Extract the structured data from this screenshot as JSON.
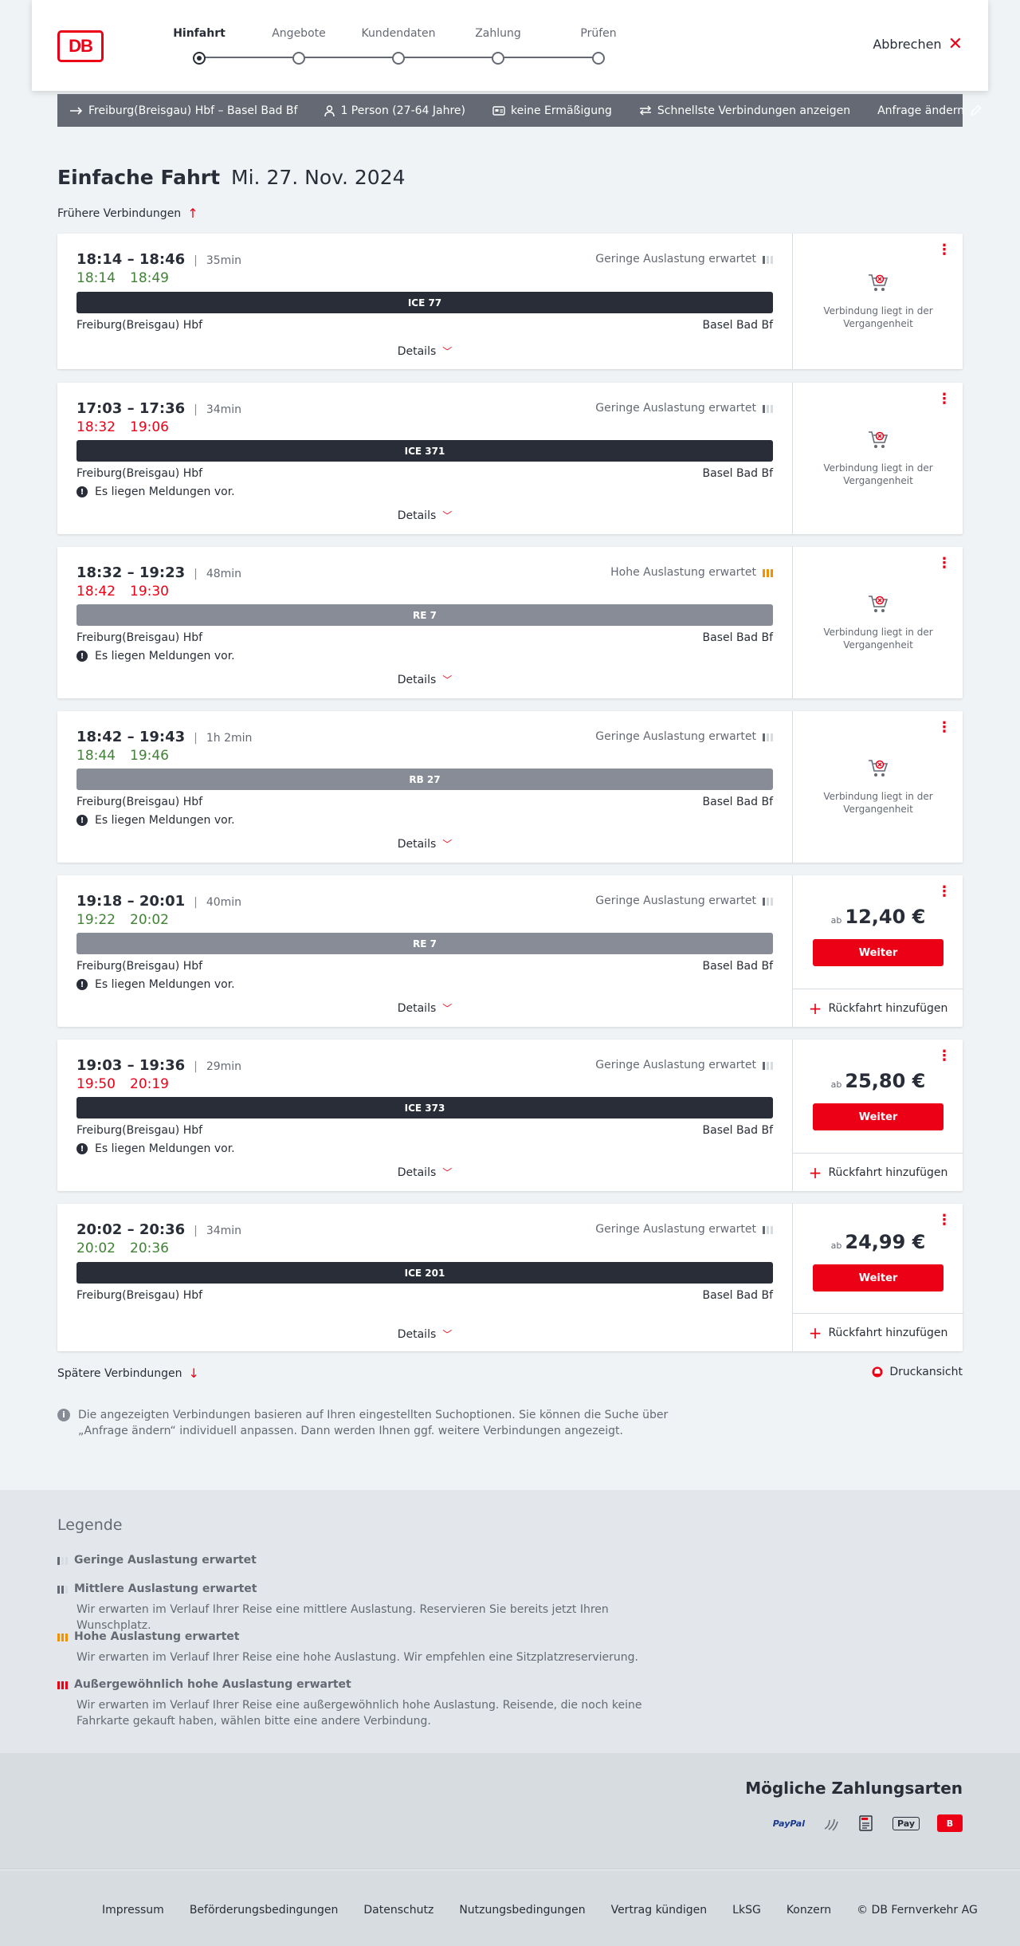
{
  "header": {
    "logo_text": "DB",
    "steps": [
      "Hinfahrt",
      "Angebote",
      "Kundendaten",
      "Zahlung",
      "Prüfen"
    ],
    "cancel_label": "Abbrechen"
  },
  "summary": {
    "route": "Freiburg(Breisgau) Hbf – Basel Bad Bf",
    "persons": "1 Person (27-64 Jahre)",
    "discount": "keine Ermäßigung",
    "fastest": "Schnellste Verbindungen anzeigen",
    "edit": "Anfrage ändern"
  },
  "title": {
    "main": "Einfache Fahrt",
    "date": "Mi. 27. Nov. 2024"
  },
  "earlier_label": "Frühere Verbindungen",
  "connections": [
    {
      "times": "18:14 – 18:46",
      "duration": "35min",
      "rt_dep": "18:14",
      "rt_arr": "18:49",
      "rt_status": "ok",
      "occupancy": "Geringe Auslastung erwartet",
      "occ_level": "low",
      "train": "ICE 77",
      "train_type": "ice",
      "from": "Freiburg(Breisgau) Hbf",
      "to": "Basel Bad Bf",
      "message": "",
      "details": "Details",
      "past": "Verbindung liegt in der Vergangenheit"
    },
    {
      "times": "17:03 – 17:36",
      "duration": "34min",
      "rt_dep": "18:32",
      "rt_arr": "19:06",
      "rt_status": "late",
      "occupancy": "Geringe Auslastung erwartet",
      "occ_level": "low",
      "train": "ICE 371",
      "train_type": "ice",
      "from": "Freiburg(Breisgau) Hbf",
      "to": "Basel Bad Bf",
      "message": "Es liegen Meldungen vor.",
      "details": "Details",
      "past": "Verbindung liegt in der Vergangenheit"
    },
    {
      "times": "18:32 – 19:23",
      "duration": "48min",
      "rt_dep": "18:42",
      "rt_arr": "19:30",
      "rt_status": "late",
      "occupancy": "Hohe Auslastung erwartet",
      "occ_level": "high",
      "train": "RE 7",
      "train_type": "regio",
      "from": "Freiburg(Breisgau) Hbf",
      "to": "Basel Bad Bf",
      "message": "Es liegen Meldungen vor.",
      "details": "Details",
      "past": "Verbindung liegt in der Vergangenheit"
    },
    {
      "times": "18:42 – 19:43",
      "duration": "1h 2min",
      "rt_dep": "18:44",
      "rt_arr": "19:46",
      "rt_status": "ok",
      "occupancy": "Geringe Auslastung erwartet",
      "occ_level": "low",
      "train": "RB 27",
      "train_type": "regio",
      "from": "Freiburg(Breisgau) Hbf",
      "to": "Basel Bad Bf",
      "message": "Es liegen Meldungen vor.",
      "details": "Details",
      "past": "Verbindung liegt in der Vergangenheit"
    },
    {
      "times": "19:18 – 20:01",
      "duration": "40min",
      "rt_dep": "19:22",
      "rt_arr": "20:02",
      "rt_status": "ok",
      "occupancy": "Geringe Auslastung erwartet",
      "occ_level": "low",
      "train": "RE 7",
      "train_type": "regio",
      "from": "Freiburg(Breisgau) Hbf",
      "to": "Basel Bad Bf",
      "message": "Es liegen Meldungen vor.",
      "details": "Details",
      "price_prefix": "ab",
      "price": "12,40 €",
      "cta": "Weiter",
      "return_label": "Rückfahrt hinzufügen"
    },
    {
      "times": "19:03 – 19:36",
      "duration": "29min",
      "rt_dep": "19:50",
      "rt_arr": "20:19",
      "rt_status": "late",
      "occupancy": "Geringe Auslastung erwartet",
      "occ_level": "low",
      "train": "ICE 373",
      "train_type": "ice",
      "from": "Freiburg(Breisgau) Hbf",
      "to": "Basel Bad Bf",
      "message": "Es liegen Meldungen vor.",
      "details": "Details",
      "price_prefix": "ab",
      "price": "25,80 €",
      "cta": "Weiter",
      "return_label": "Rückfahrt hinzufügen"
    },
    {
      "times": "20:02 – 20:36",
      "duration": "34min",
      "rt_dep": "20:02",
      "rt_arr": "20:36",
      "rt_status": "ok",
      "occupancy": "Geringe Auslastung erwartet",
      "occ_level": "low",
      "train": "ICE 201",
      "train_type": "ice",
      "from": "Freiburg(Breisgau) Hbf",
      "to": "Basel Bad Bf",
      "message": "",
      "details": "Details",
      "price_prefix": "ab",
      "price": "24,99 €",
      "cta": "Weiter",
      "return_label": "Rückfahrt hinzufügen"
    }
  ],
  "later_label": "Spätere Verbindungen",
  "print_label": "Druckansicht",
  "info_text": "Die angezeigten Verbindungen basieren auf Ihren eingestellten Suchoptionen. Sie können die Suche über „Anfrage ändern“ individuell anpassen. Dann werden Ihnen ggf. weitere Verbindungen angezeigt.",
  "legend": {
    "title": "Legende",
    "items": [
      {
        "title": "Geringe Auslastung erwartet",
        "desc": ""
      },
      {
        "title": "Mittlere Auslastung erwartet",
        "desc": "Wir erwarten im Verlauf Ihrer Reise eine mittlere Auslastung. Reservieren Sie bereits jetzt Ihren Wunschplatz."
      },
      {
        "title": "Hohe Auslastung erwartet",
        "desc": "Wir erwarten im Verlauf Ihrer Reise eine hohe Auslastung. Wir empfehlen eine Sitzplatzreservierung."
      },
      {
        "title": "Außergewöhnlich hohe Auslastung erwartet",
        "desc": "Wir erwarten im Verlauf Ihrer Reise eine außergewöhnlich hohe Auslastung. Reisende, die noch keine Fahrkarte gekauft haben, wählen bitte eine andere Verbindung."
      }
    ]
  },
  "payment": {
    "title": "Mögliche Zahlungsarten",
    "paypal": "PayPal",
    "applepay": "Pay"
  },
  "footer": {
    "links": [
      "Impressum",
      "Beförderungsbedingungen",
      "Datenschutz",
      "Nutzungsbedingungen",
      "Vertrag kündigen",
      "LkSG",
      "Konzern",
      "© DB Fernverkehr AG"
    ]
  },
  "colors": {
    "db_red": "#ec0016",
    "on_time": "#408335",
    "dark": "#282d37",
    "high_occupancy": "#f39200"
  }
}
